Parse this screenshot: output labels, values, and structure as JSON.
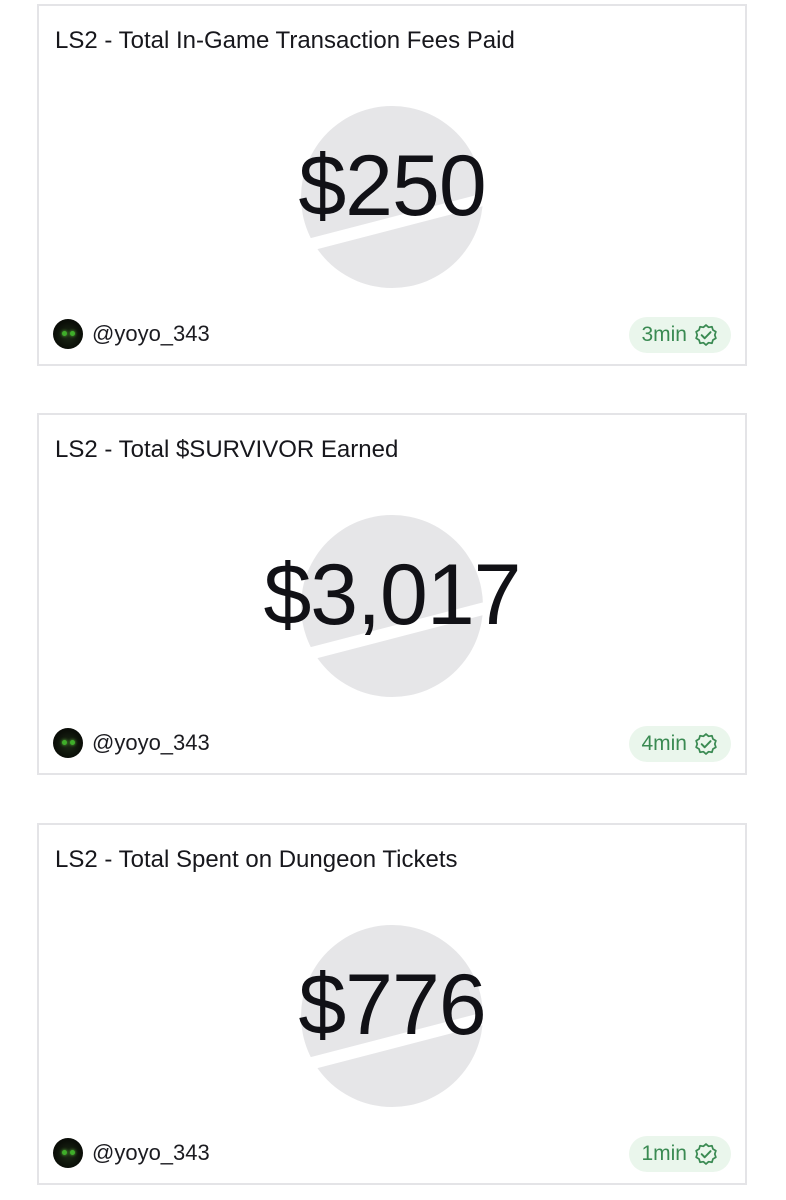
{
  "cards": [
    {
      "title": "LS2 - Total In-Game Transaction Fees Paid",
      "value": "$250",
      "author": "@yoyo_343",
      "age": "3min",
      "icon": "verified-check-icon"
    },
    {
      "title": "LS2 - Total $SURVIVOR Earned",
      "value": "$3,017",
      "author": "@yoyo_343",
      "age": "4min",
      "icon": "verified-check-icon"
    },
    {
      "title": "LS2 - Total Spent on Dungeon Tickets",
      "value": "$776",
      "author": "@yoyo_343",
      "age": "1min",
      "icon": "verified-check-icon"
    }
  ],
  "colors": {
    "badge_bg": "#eaf6ec",
    "badge_text": "#3a8a52",
    "watermark": "#e6e6e8",
    "border": "#e4e4e7"
  }
}
